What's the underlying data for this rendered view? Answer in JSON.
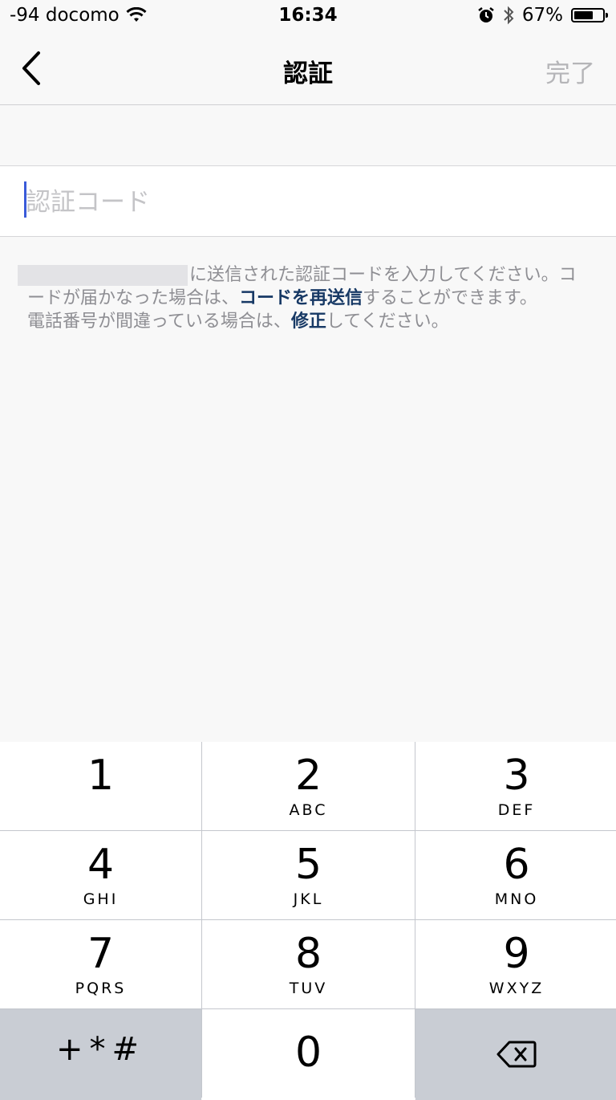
{
  "status_bar": {
    "carrier": "-94 docomo",
    "time": "16:34",
    "battery": "67%",
    "battery_level": 0.67
  },
  "nav": {
    "title": "認証",
    "done_label": "完了"
  },
  "input": {
    "placeholder": "認証コード"
  },
  "description": {
    "line1_suffix": "に送信された認証コードを入力してください。コードが届かなった場合は、",
    "resend_link": "コードを再送信",
    "line1_end": "することができます。",
    "line2_prefix": "電話番号が間違っている場合は、",
    "fix_link": "修正",
    "line2_end": "してください。"
  },
  "keypad": {
    "keys": [
      {
        "num": "1",
        "letters": ""
      },
      {
        "num": "2",
        "letters": "ABC"
      },
      {
        "num": "3",
        "letters": "DEF"
      },
      {
        "num": "4",
        "letters": "GHI"
      },
      {
        "num": "5",
        "letters": "JKL"
      },
      {
        "num": "6",
        "letters": "MNO"
      },
      {
        "num": "7",
        "letters": "PQRS"
      },
      {
        "num": "8",
        "letters": "TUV"
      },
      {
        "num": "9",
        "letters": "WXYZ"
      }
    ],
    "symbols_label": "+*#",
    "zero": "0"
  }
}
